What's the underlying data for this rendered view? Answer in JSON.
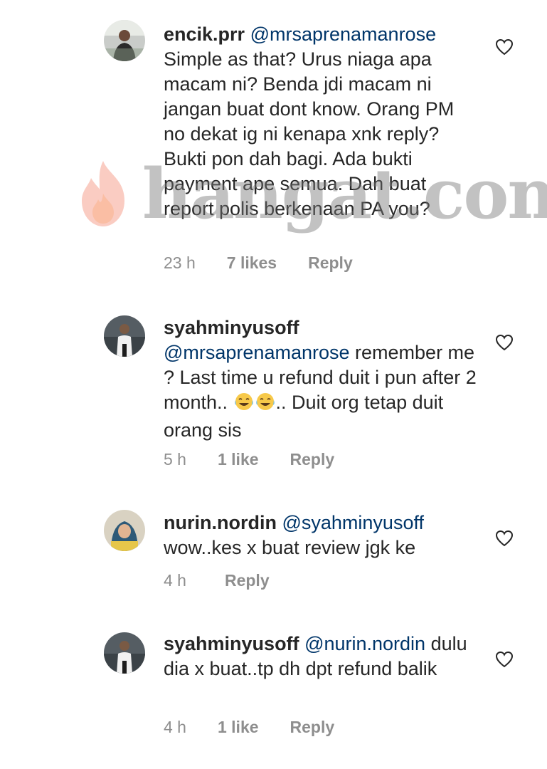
{
  "comments": [
    {
      "username": "encik.prr",
      "mention": "@mrsaprenamanrose",
      "text": "Simple as that? Urus niaga apa macam ni? Benda jdi macam ni jangan buat dont know. Orang PM no dekat ig ni kenapa xnk reply? Bukti pon dah bagi. Ada bukti payment ape semua. Dah buat report polis berkenaan PA you?",
      "time": "23 h",
      "likes": "7 likes",
      "reply": "Reply"
    },
    {
      "username": "syahminyusoff",
      "mention": "@mrsaprenamanrose",
      "text_before_emoji": "remember me ? Last time u refund duit i pun after 2 month.. ",
      "text_after_emoji": ".. Duit org tetap duit orang sis",
      "time": "5 h",
      "likes": "1 like",
      "reply": "Reply"
    },
    {
      "username": "nurin.nordin",
      "mention": "@syahminyusoff",
      "text": "wow..kes x buat review jgk ke",
      "time": "4 h",
      "reply": "Reply"
    },
    {
      "username": "syahminyusoff",
      "mention": "@nurin.nordin",
      "text": "dulu dia x buat..tp dh dpt refund balik",
      "time": "4 h",
      "likes": "1 like",
      "reply": "Reply"
    }
  ],
  "watermark": {
    "text": "hangat.com"
  },
  "icons": {
    "like": "heart-outline-icon",
    "emoji": "tears-of-joy-emoji"
  },
  "colors": {
    "text": "#262626",
    "mention": "#003569",
    "meta": "#8e8e8e"
  }
}
